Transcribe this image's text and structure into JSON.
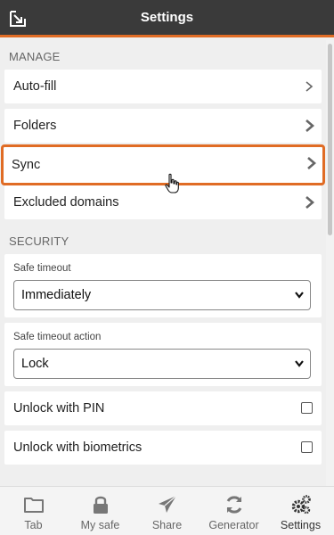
{
  "header": {
    "title": "Settings"
  },
  "manage": {
    "title": "MANAGE",
    "items": [
      {
        "label": "Auto-fill"
      },
      {
        "label": "Folders"
      },
      {
        "label": "Sync"
      },
      {
        "label": "Excluded domains"
      }
    ]
  },
  "security": {
    "title": "SECURITY",
    "timeout": {
      "label": "Safe timeout",
      "value": "Immediately"
    },
    "timeout_action": {
      "label": "Safe timeout action",
      "value": "Lock"
    },
    "unlock_pin": {
      "label": "Unlock with PIN",
      "checked": false
    },
    "unlock_biometrics": {
      "label": "Unlock with biometrics",
      "checked": false
    }
  },
  "tabs": [
    {
      "label": "Tab",
      "icon": "folder-icon"
    },
    {
      "label": "My safe",
      "icon": "lock-icon"
    },
    {
      "label": "Share",
      "icon": "paper-plane-icon"
    },
    {
      "label": "Generator",
      "icon": "refresh-icon"
    },
    {
      "label": "Settings",
      "icon": "gears-icon",
      "active": true
    }
  ],
  "colors": {
    "accent": "#e06c25",
    "header_bg": "#3a3a3a",
    "background": "#efefef"
  }
}
